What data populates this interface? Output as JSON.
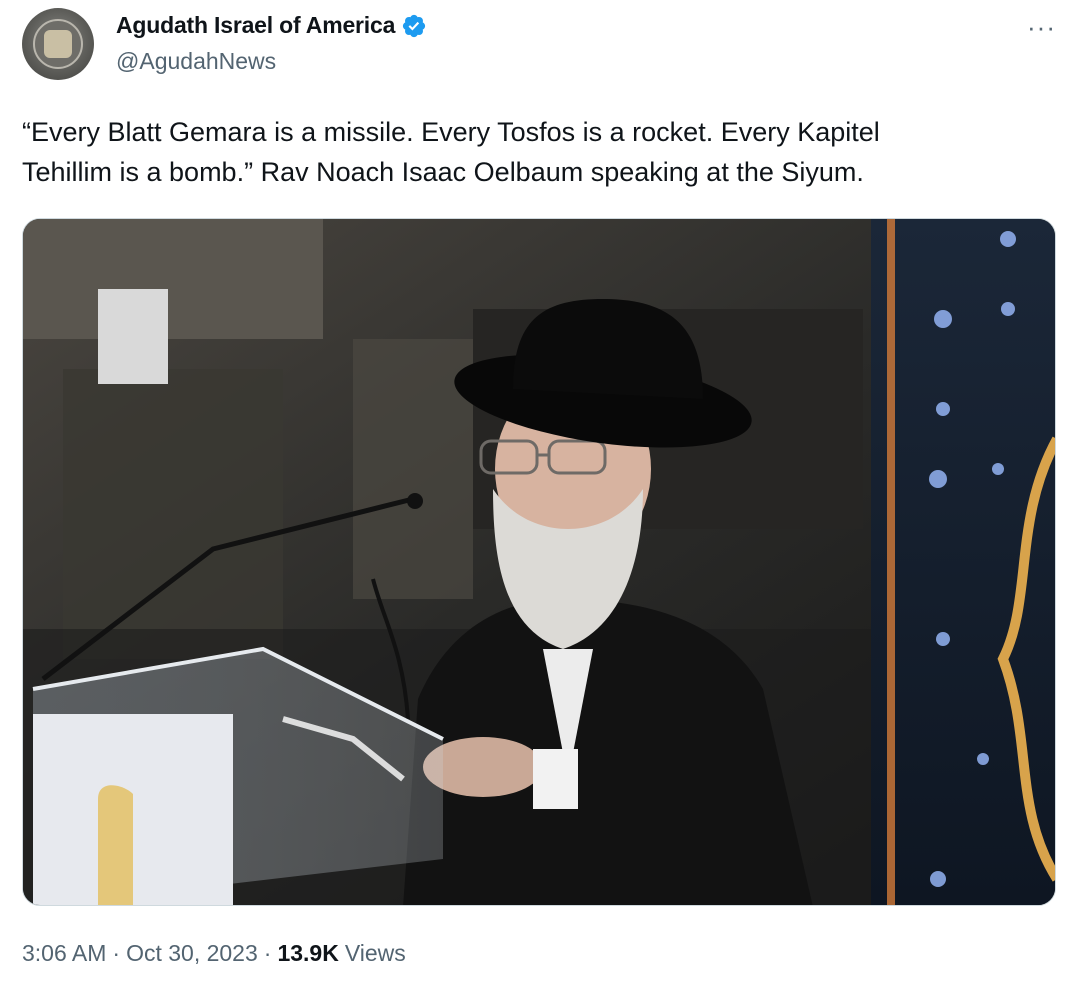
{
  "author": {
    "name": "Agudath Israel of America",
    "handle": "@AgudahNews"
  },
  "more_label": "···",
  "tweet": {
    "line1": "“Every Blatt Gemara is a missile. Every Tosfos is a rocket. Every Kapitel",
    "line2": "Tehillim is a bomb.” Rav Noach Isaac Oelbaum speaking at the Siyum."
  },
  "meta": {
    "time": "3:06 AM",
    "sep1": "·",
    "date": "Oct 30, 2023",
    "sep2": "·",
    "views_count": "13.9K",
    "views_label": "Views"
  },
  "colors": {
    "verified": "#1d9bf0",
    "secondary_text": "#536471",
    "primary_text": "#0f1419"
  }
}
